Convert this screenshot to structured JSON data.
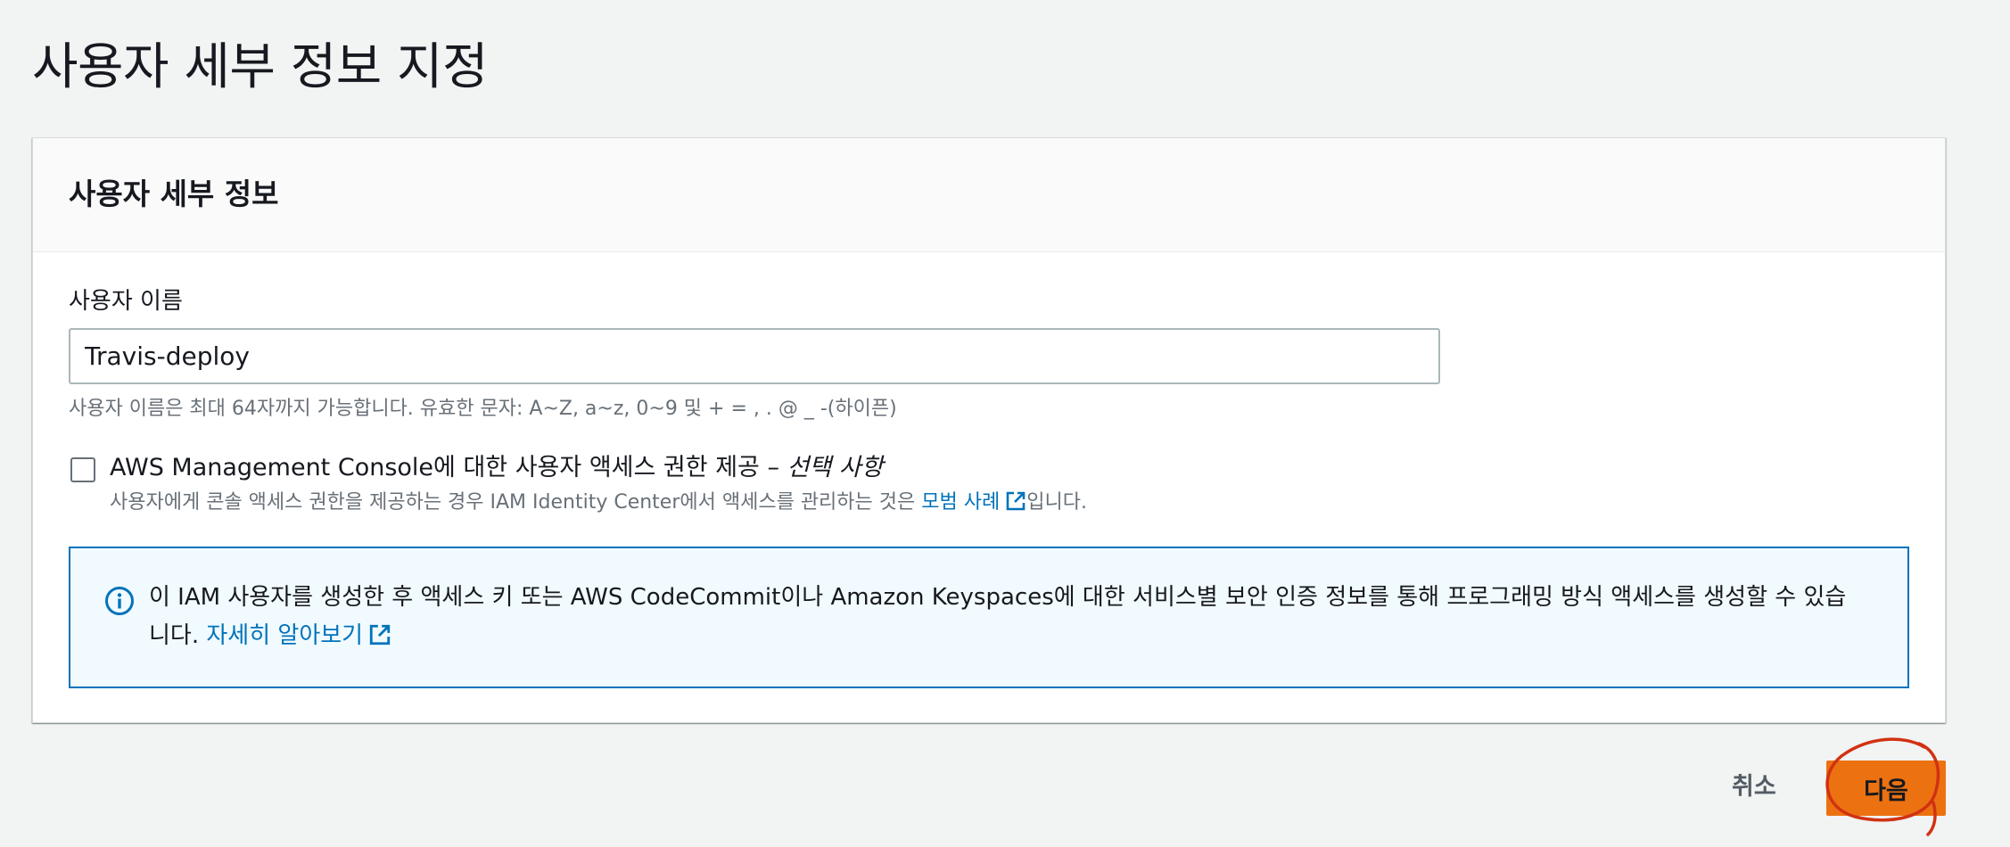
{
  "page": {
    "title": "사용자 세부 정보 지정"
  },
  "panel": {
    "title": "사용자 세부 정보",
    "username_label": "사용자 이름",
    "username_value": "Travis-deploy",
    "username_help": "사용자 이름은 최대 64자까지 가능합니다. 유효한 문자: A~Z, a~z, 0~9 및 + = , . @ _ -(하이픈)",
    "console_access": {
      "checked": false,
      "label": "AWS Management Console에 대한 사용자 액세스 권한 제공 – ",
      "label_optional": "선택 사항",
      "desc_before": "사용자에게 콘솔 액세스 권한을 제공하는 경우 IAM Identity Center에서 액세스를 관리하는 것은 ",
      "desc_link": "모범 사례",
      "desc_after": "입니다."
    },
    "info": {
      "text": "이 IAM 사용자를 생성한 후 액세스 키 또는 AWS CodeCommit이나 Amazon Keyspaces에 대한 서비스별 보안 인증 정보를 통해 프로그래밍 방식 액세스를 생성할 수 있습니다. ",
      "link": "자세히 알아보기"
    }
  },
  "footer": {
    "cancel_label": "취소",
    "next_label": "다음"
  },
  "icons": {
    "info": "info-icon",
    "external_link": "external-link-icon"
  },
  "colors": {
    "primary": "#ec7211",
    "link": "#0073bb",
    "info_background": "#f1faff",
    "annotation": "#d13212"
  }
}
